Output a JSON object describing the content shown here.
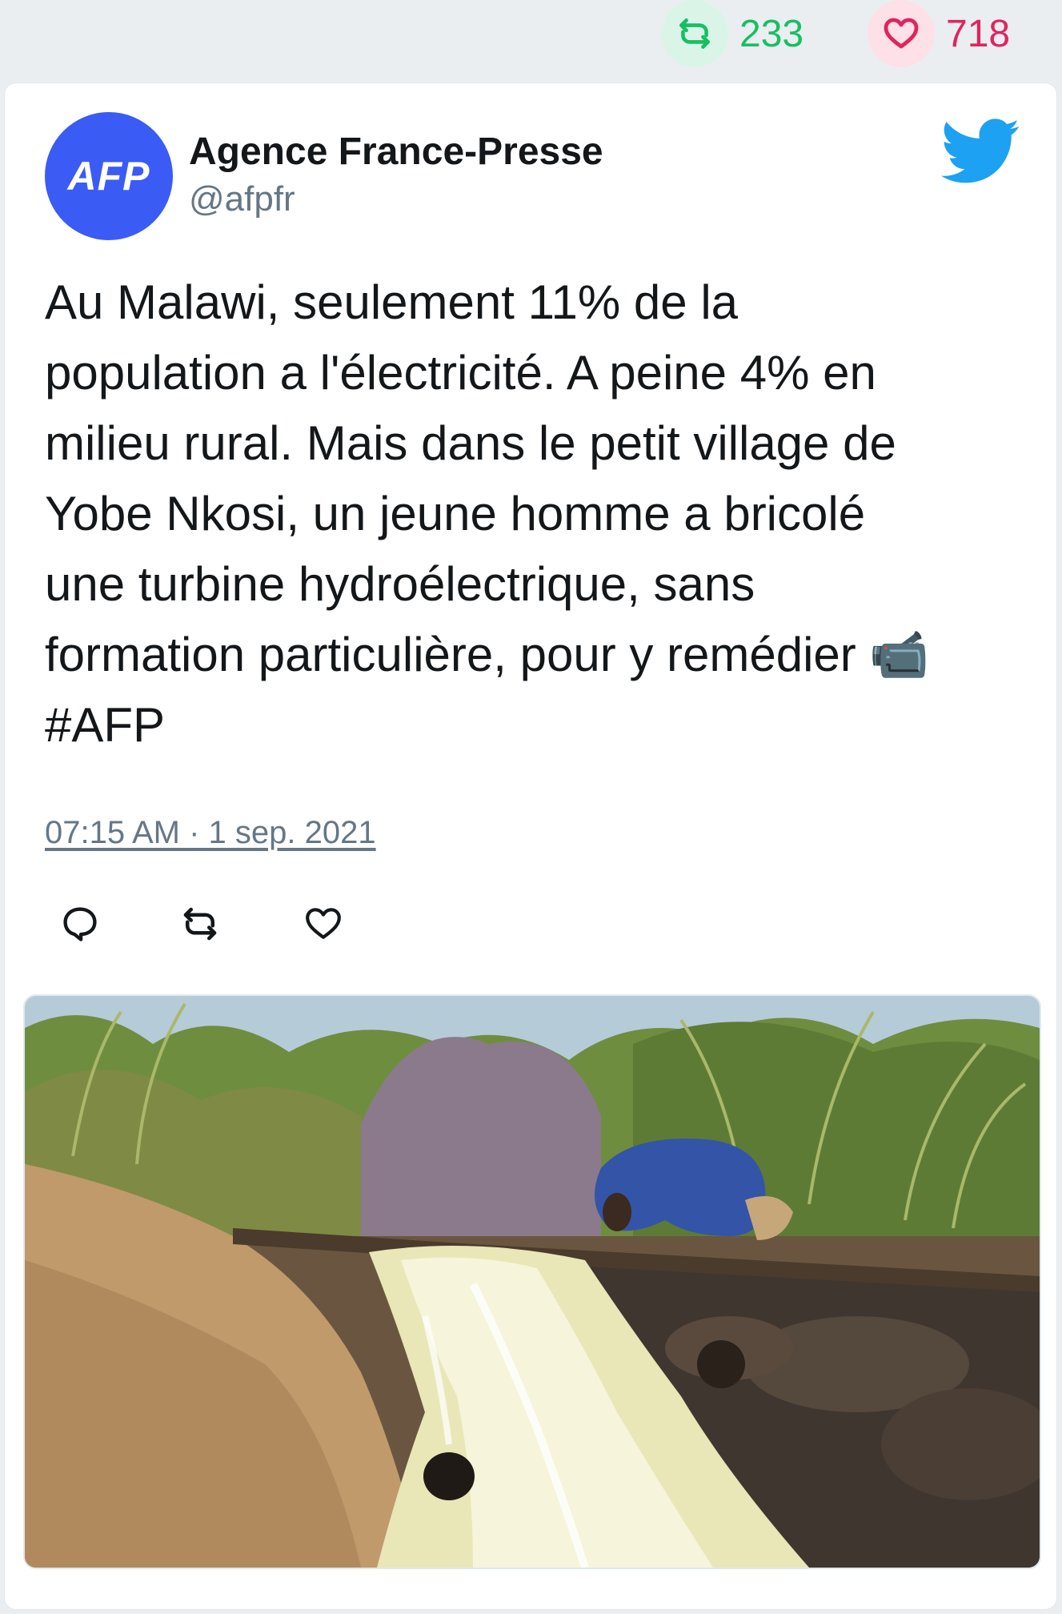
{
  "stats": {
    "retweets": "233",
    "likes": "718",
    "retweet_icon": "retweet-icon",
    "like_icon": "heart-icon"
  },
  "tweet": {
    "author_name": "Agence France-Presse",
    "author_handle": "@afpfr",
    "avatar_text": "AFP",
    "text": "Au Malawi, seulement 11% de la\npopulation a l'électricité. A peine 4% en\nmilieu rural. Mais dans le petit village de\nYobe Nkosi, un jeune homme a bricolé\nune turbine hydroélectrique, sans\nformation particulière, pour y remédier 📹\n#AFP",
    "timestamp": "07:15 AM · 1 sep. 2021",
    "platform_icon": "twitter-bird-icon"
  },
  "actions": {
    "reply_icon": "reply-icon",
    "retweet_icon": "retweet-icon",
    "like_icon": "heart-icon"
  },
  "media": {
    "icon": "video-thumbnail"
  },
  "colors": {
    "background": "#ebeef0",
    "retweet_green": "#17bf63",
    "like_red": "#e0245e",
    "twitter_blue": "#1da1f2",
    "avatar_blue": "#3b5bf5",
    "muted_text": "#657786"
  }
}
